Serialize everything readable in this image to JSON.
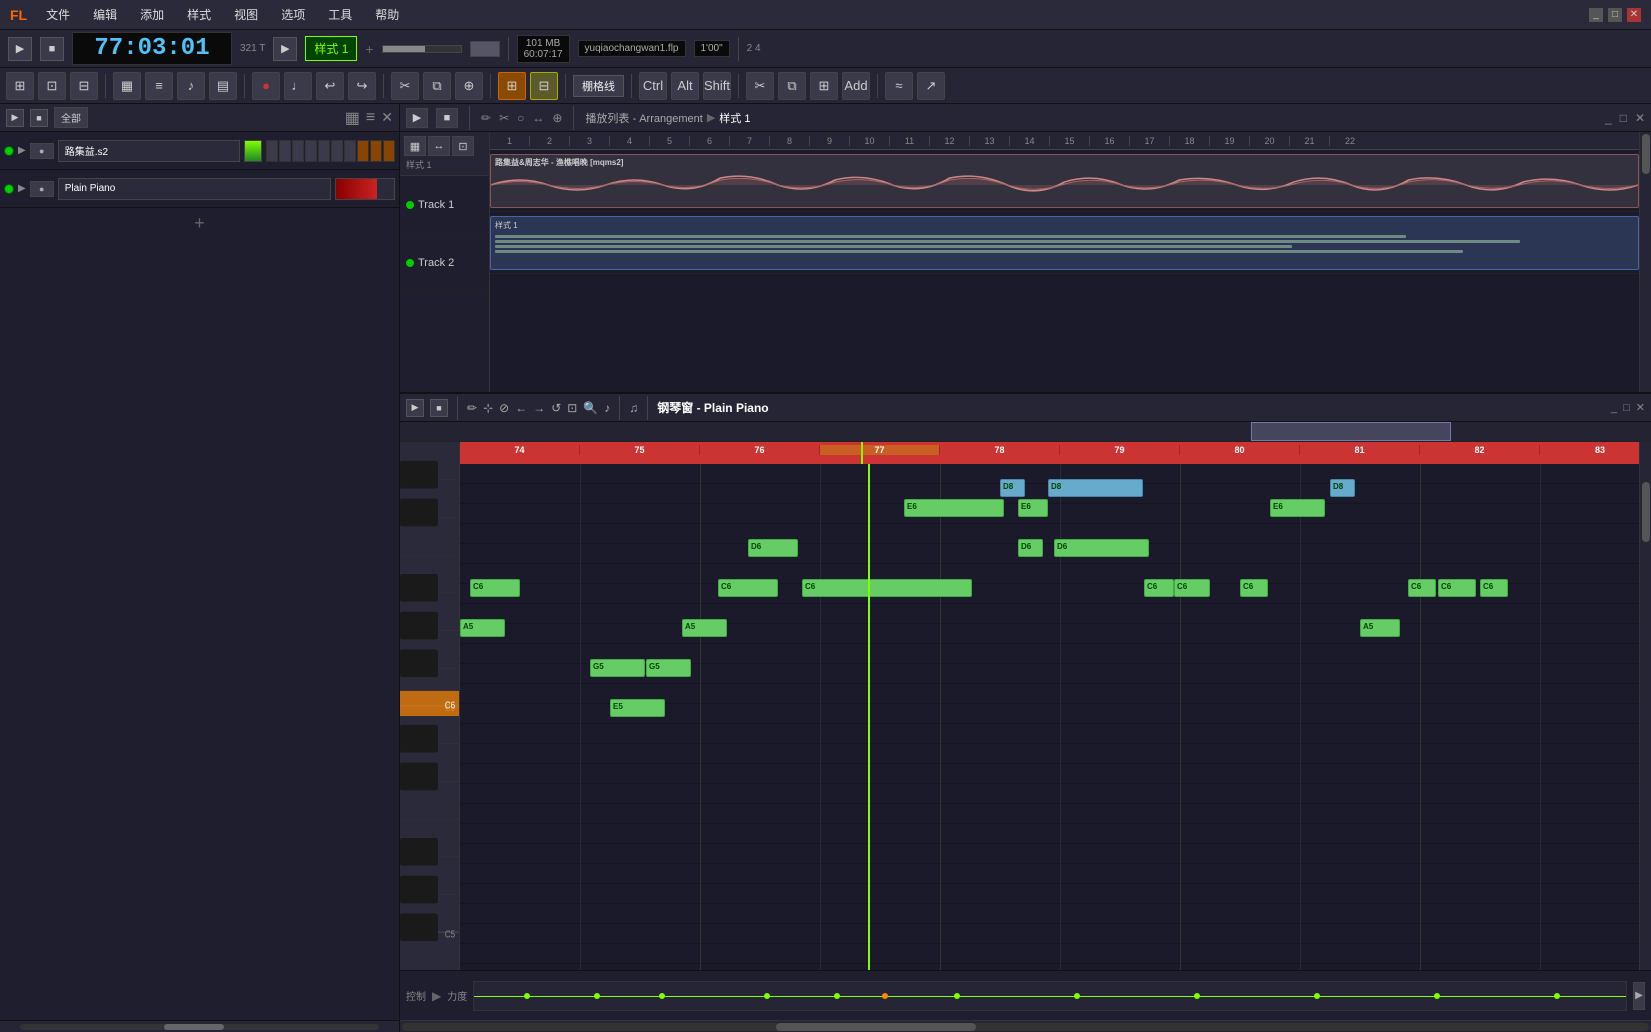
{
  "app": {
    "title": "FL Studio",
    "file": "yuqiaochangwan1.flp"
  },
  "menu": {
    "items": [
      "文件",
      "编辑",
      "添加",
      "样式",
      "视图",
      "选项",
      "工具",
      "帮助"
    ]
  },
  "transport": {
    "time_display": "77:03:01",
    "time_sub": "321 T",
    "bpm_label": "101 MB",
    "time_secondary": "60:07:17",
    "zoom_label": "1'00\"",
    "pattern_name": "样式 1",
    "divider": "2 4"
  },
  "channel_rack": {
    "header_label": "全部",
    "channels": [
      {
        "name": "路集益.s2",
        "type": "audio",
        "active": true
      },
      {
        "name": "Plain Piano",
        "type": "midi",
        "active": true
      }
    ]
  },
  "song_editor": {
    "title": "播放列表 - Arrangement",
    "pattern": "样式 1",
    "ruler_marks": [
      "1",
      "2",
      "3",
      "4",
      "5",
      "6",
      "7",
      "8",
      "9",
      "10",
      "11",
      "12",
      "13",
      "14",
      "15",
      "16",
      "17",
      "18",
      "19",
      "20",
      "21",
      "22"
    ],
    "tracks": [
      {
        "name": "Track 1",
        "content": "路集益&周志华 - 渔樵唱晚 [mqms2]",
        "type": "audio"
      },
      {
        "name": "Track 2",
        "content": "样式 1",
        "type": "midi"
      }
    ]
  },
  "piano_roll": {
    "title": "钢琴窗 - Plain Piano",
    "ruler_marks": [
      "74",
      "75",
      "76",
      "77",
      "78",
      "79",
      "80",
      "81",
      "82",
      "83"
    ],
    "notes": [
      {
        "note": "C6",
        "beat": 0,
        "x_pct": 1.5,
        "w_pct": 3.5,
        "row": "C6"
      },
      {
        "note": "A5",
        "beat": 0,
        "x_pct": 0,
        "w_pct": 3.5,
        "row": "A5"
      },
      {
        "note": "G5",
        "beat": 2,
        "x_pct": 11,
        "w_pct": 4.5,
        "row": "G5"
      },
      {
        "note": "G5",
        "beat": 2.5,
        "x_pct": 15.5,
        "w_pct": 3.5,
        "row": "G5"
      },
      {
        "note": "E5",
        "beat": 2,
        "x_pct": 12.5,
        "w_pct": 3.5,
        "row": "E5"
      },
      {
        "note": "A5",
        "beat": 1.5,
        "x_pct": 18.5,
        "w_pct": 3,
        "row": "A5"
      },
      {
        "note": "D6",
        "beat": 2,
        "x_pct": 24,
        "w_pct": 3.5,
        "row": "D6"
      },
      {
        "note": "C6",
        "beat": 2,
        "x_pct": 21.5,
        "w_pct": 4.5,
        "row": "C6"
      },
      {
        "note": "C6",
        "beat": 3,
        "x_pct": 28.5,
        "w_pct": 4.5,
        "row": "C6"
      },
      {
        "note": "E6",
        "beat": 3.5,
        "x_pct": 37,
        "w_pct": 8.5,
        "row": "E6"
      },
      {
        "note": "D8",
        "beat": 4,
        "x_pct": 45,
        "w_pct": 2,
        "row": "D8"
      },
      {
        "note": "D6",
        "beat": 4,
        "x_pct": 46.5,
        "w_pct": 2,
        "row": "D6"
      },
      {
        "note": "E6",
        "beat": 4,
        "x_pct": 46.5,
        "w_pct": 2.5,
        "row": "E6"
      },
      {
        "note": "D8",
        "beat": 4.5,
        "x_pct": 49,
        "w_pct": 8,
        "row": "D8"
      },
      {
        "note": "D6",
        "beat": 4.5,
        "x_pct": 49.5,
        "w_pct": 8,
        "row": "D6"
      },
      {
        "note": "C6",
        "beat": 4.5,
        "x_pct": 57,
        "w_pct": 2.5,
        "row": "C6"
      },
      {
        "note": "C6",
        "beat": 5,
        "x_pct": 59.5,
        "w_pct": 3,
        "row": "C6"
      },
      {
        "note": "C6",
        "beat": 5.5,
        "x_pct": 65,
        "w_pct": 2,
        "row": "C6"
      },
      {
        "note": "A5",
        "beat": 5.5,
        "x_pct": 75,
        "w_pct": 3.5,
        "row": "A5"
      },
      {
        "note": "E6",
        "beat": 6,
        "x_pct": 67.5,
        "w_pct": 4.5,
        "row": "E6"
      },
      {
        "note": "D8",
        "beat": 6,
        "x_pct": 72.5,
        "w_pct": 2,
        "row": "D8"
      },
      {
        "note": "C6",
        "beat": 6.5,
        "x_pct": 79,
        "w_pct": 2,
        "row": "C6"
      },
      {
        "note": "C6",
        "beat": 7,
        "x_pct": 82,
        "w_pct": 6,
        "row": "C6"
      }
    ],
    "playhead_x_pct": 34,
    "current_note": "C6"
  },
  "controls": {
    "label": "控制",
    "sublabel": "力度"
  },
  "colors": {
    "bg_dark": "#1a1a2a",
    "bg_mid": "#252535",
    "bg_light": "#3a3a4a",
    "accent_green": "#7fff00",
    "accent_orange": "#ff8800",
    "note_green": "#66cc66",
    "timeline_red": "#cc3333",
    "text_bright": "#ffffff",
    "text_dim": "#888888"
  }
}
